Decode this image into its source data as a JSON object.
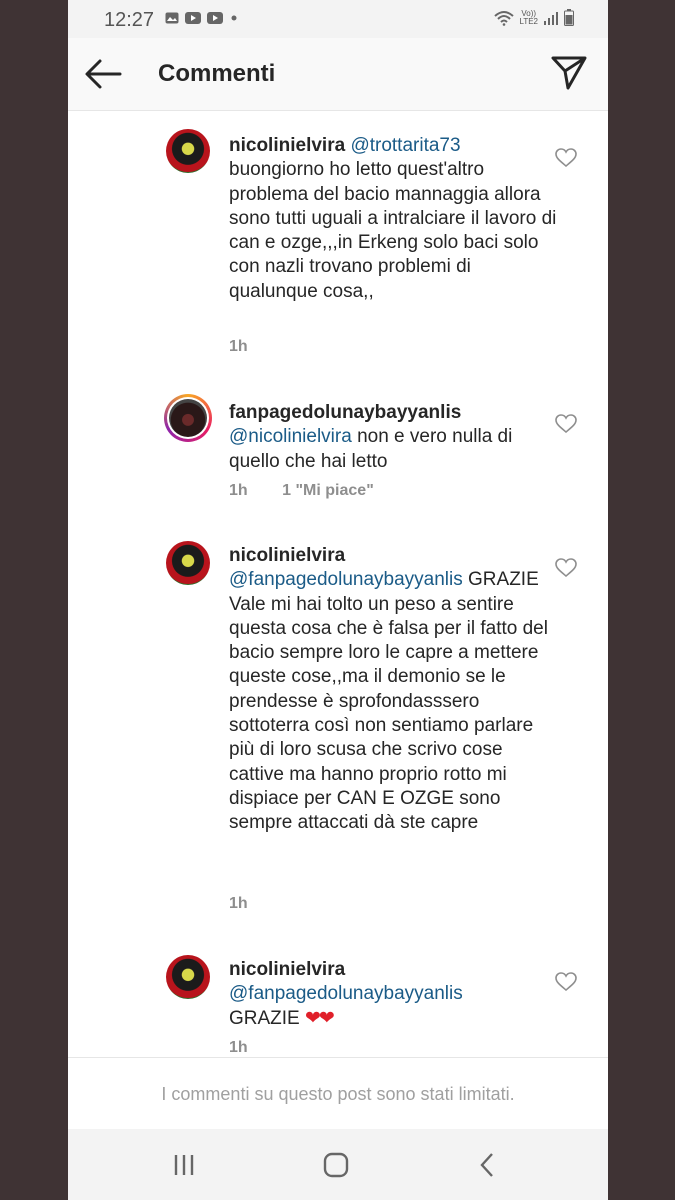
{
  "status_bar": {
    "time": "12:27",
    "network_label_top": "Vo))",
    "network_label_bottom": "LTE2",
    "icons": [
      "gallery-icon",
      "youtube-icon",
      "youtube-icon",
      "dot-icon",
      "wifi-icon",
      "signal-icon",
      "battery-icon"
    ]
  },
  "header": {
    "title": "Commenti",
    "back_icon": "arrow-left-icon",
    "send_icon": "paper-plane-icon"
  },
  "comments": [
    {
      "username": "nicolinielvira",
      "mention": "@trottarita73",
      "text": "buongiorno ho letto quest'altro problema del bacio mannaggia allora sono tutti uguali a intralciare il lavoro di can e ozge,,,in Erkeng solo baci solo con nazli trovano problemi di qualunque cosa,,",
      "time": "1h",
      "likes": ""
    },
    {
      "username": "fanpagedolunaybayyanlis",
      "mention": "@nicolinielvira",
      "text": "non e vero nulla di quello che hai letto",
      "time": "1h",
      "likes": "1 \"Mi piace\""
    },
    {
      "username": "nicolinielvira",
      "mention": "@fanpagedolunaybayyanlis",
      "text": "GRAZIE Vale mi hai tolto un peso a sentire questa cosa che è falsa per il fatto del bacio sempre loro le capre a mettere queste cose,,ma il demonio se le prendesse è sprofondasssero sottoterra così non sentiamo parlare più di loro scusa che scrivo cose cattive ma hanno proprio rotto mi dispiace per CAN E OZGE sono sempre attaccati dà ste capre",
      "time": "1h",
      "likes": ""
    },
    {
      "username": "nicolinielvira",
      "mention": "@fanpagedolunaybayyanlis",
      "text": "GRAZIE",
      "emoji": "❤❤",
      "time": "1h",
      "likes": ""
    }
  ],
  "footer": {
    "limited_message": "I commenti su questo post sono stati limitati."
  },
  "nav_bar": {
    "icons": [
      "recent-apps-icon",
      "home-icon",
      "back-icon"
    ]
  },
  "colors": {
    "mention": "#1b5b87",
    "heart_emoji": "#e0202a",
    "background_frame": "#3f3334"
  }
}
